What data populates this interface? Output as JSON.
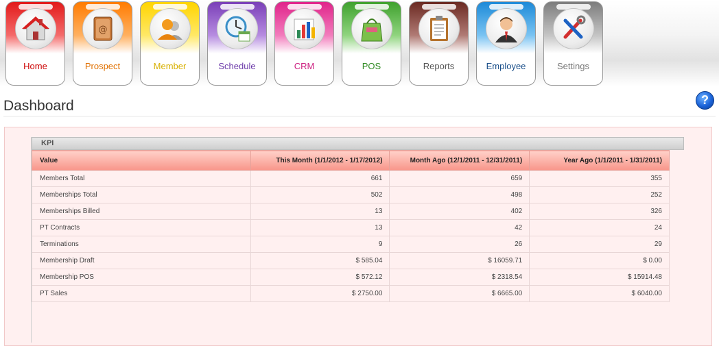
{
  "nav": [
    {
      "label": "Home",
      "icon": "home-icon",
      "c1": "#e21a1a",
      "c2": "#f46a6a",
      "lc": "#cc0000"
    },
    {
      "label": "Prospect",
      "icon": "address-book-icon",
      "c1": "#ff7b00",
      "c2": "#ffb060",
      "lc": "#e07000"
    },
    {
      "label": "Member",
      "icon": "member-icon",
      "c1": "#ffd400",
      "c2": "#ffe866",
      "lc": "#d8b000"
    },
    {
      "label": "Schedule",
      "icon": "clock-calendar-icon",
      "c1": "#7a3fb8",
      "c2": "#b68ce0",
      "lc": "#6a38a8"
    },
    {
      "label": "CRM",
      "icon": "chart-bars-icon",
      "c1": "#e0248a",
      "c2": "#f27cbc",
      "lc": "#cc2080"
    },
    {
      "label": "POS",
      "icon": "shopping-bag-icon",
      "c1": "#3fa12e",
      "c2": "#8fd47e",
      "lc": "#2f8a22"
    },
    {
      "label": "Reports",
      "icon": "clipboard-icon",
      "c1": "#6b2a22",
      "c2": "#b07a74",
      "lc": "#555555"
    },
    {
      "label": "Employee",
      "icon": "employee-icon",
      "c1": "#1d8ad8",
      "c2": "#79c3f2",
      "lc": "#1a4f8a"
    },
    {
      "label": "Settings",
      "icon": "tools-icon",
      "c1": "#7c7c7c",
      "c2": "#c4c4c4",
      "lc": "#777777"
    }
  ],
  "page": {
    "title": "Dashboard",
    "help": "?"
  },
  "kpi": {
    "title": "KPI",
    "columns": [
      "Value",
      "This Month (1/1/2012 - 1/17/2012)",
      "Month Ago (12/1/2011 - 12/31/2011)",
      "Year Ago (1/1/2011 - 1/31/2011)"
    ],
    "rows": [
      [
        "Members Total",
        "661",
        "659",
        "355"
      ],
      [
        "Memberships Total",
        "502",
        "498",
        "252"
      ],
      [
        "Memberships Billed",
        "13",
        "402",
        "326"
      ],
      [
        "PT Contracts",
        "13",
        "42",
        "24"
      ],
      [
        "Terminations",
        "9",
        "26",
        "29"
      ],
      [
        "Membership Draft",
        "$ 585.04",
        "$ 16059.71",
        "$ 0.00"
      ],
      [
        "Membership POS",
        "$ 572.12",
        "$ 2318.54",
        "$ 15914.48"
      ],
      [
        "PT Sales",
        "$ 2750.00",
        "$ 6665.00",
        "$ 6040.00"
      ]
    ]
  }
}
